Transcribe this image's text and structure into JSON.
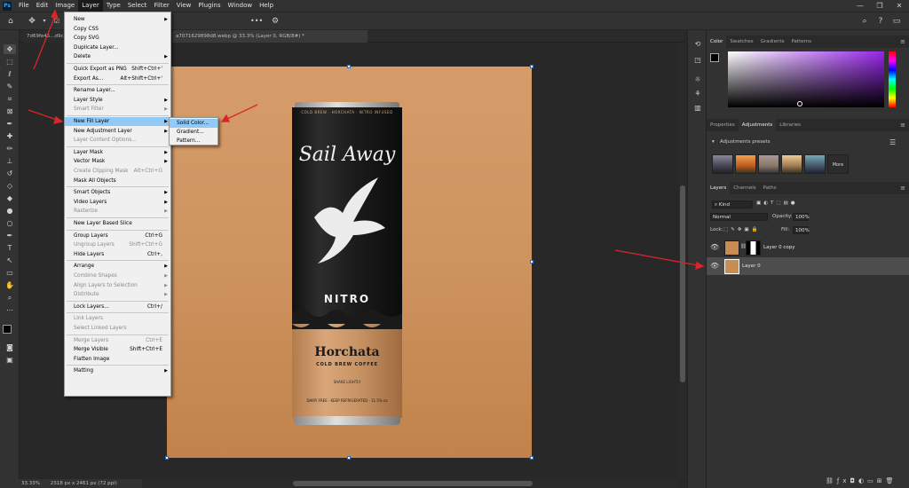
{
  "menubar": {
    "logo": "Ps",
    "items": [
      "File",
      "Edit",
      "Image",
      "Layer",
      "Type",
      "Select",
      "Filter",
      "View",
      "Plugins",
      "Window",
      "Help"
    ],
    "active": "Layer",
    "window_controls": [
      "—",
      "❐",
      "✕"
    ]
  },
  "document": {
    "tab_left": "7d69fe45...d9c69",
    "tab_right": "a7071629898d8.webp @ 33.3% (Layer 0, RGB/8#) *",
    "zoom": "33.33%",
    "doc_info": "2318 px x 2461 px (72 ppi)"
  },
  "layer_menu": {
    "items": [
      {
        "label": "New",
        "shortcut": "",
        "submenu": true,
        "disabled": false
      },
      {
        "label": "Copy CSS",
        "shortcut": "",
        "submenu": false,
        "disabled": false
      },
      {
        "label": "Copy SVG",
        "shortcut": "",
        "submenu": false,
        "disabled": false
      },
      {
        "label": "Duplicate Layer...",
        "shortcut": "",
        "submenu": false,
        "disabled": false
      },
      {
        "label": "Delete",
        "shortcut": "",
        "submenu": true,
        "disabled": false
      },
      {
        "label": "Quick Export as PNG",
        "shortcut": "Shift+Ctrl+'",
        "submenu": false,
        "disabled": false
      },
      {
        "label": "Export As...",
        "shortcut": "Alt+Shift+Ctrl+'",
        "submenu": false,
        "disabled": false
      },
      {
        "label": "Rename Layer...",
        "shortcut": "",
        "submenu": false,
        "disabled": false
      },
      {
        "label": "Layer Style",
        "shortcut": "",
        "submenu": true,
        "disabled": false
      },
      {
        "label": "Smart Filter",
        "shortcut": "",
        "submenu": true,
        "disabled": true
      },
      {
        "label": "New Fill Layer",
        "shortcut": "",
        "submenu": true,
        "disabled": false,
        "highlighted": true
      },
      {
        "label": "New Adjustment Layer",
        "shortcut": "",
        "submenu": true,
        "disabled": false
      },
      {
        "label": "Layer Content Options...",
        "shortcut": "",
        "submenu": false,
        "disabled": true
      },
      {
        "label": "Layer Mask",
        "shortcut": "",
        "submenu": true,
        "disabled": false
      },
      {
        "label": "Vector Mask",
        "shortcut": "",
        "submenu": true,
        "disabled": false
      },
      {
        "label": "Create Clipping Mask",
        "shortcut": "Alt+Ctrl+G",
        "submenu": false,
        "disabled": true
      },
      {
        "label": "Mask All Objects",
        "shortcut": "",
        "submenu": false,
        "disabled": false
      },
      {
        "label": "Smart Objects",
        "shortcut": "",
        "submenu": true,
        "disabled": false
      },
      {
        "label": "Video Layers",
        "shortcut": "",
        "submenu": true,
        "disabled": false
      },
      {
        "label": "Rasterize",
        "shortcut": "",
        "submenu": true,
        "disabled": true
      },
      {
        "label": "New Layer Based Slice",
        "shortcut": "",
        "submenu": false,
        "disabled": false
      },
      {
        "label": "Group Layers",
        "shortcut": "Ctrl+G",
        "submenu": false,
        "disabled": false
      },
      {
        "label": "Ungroup Layers",
        "shortcut": "Shift+Ctrl+G",
        "submenu": false,
        "disabled": true
      },
      {
        "label": "Hide Layers",
        "shortcut": "Ctrl+,",
        "submenu": false,
        "disabled": false
      },
      {
        "label": "Arrange",
        "shortcut": "",
        "submenu": true,
        "disabled": false
      },
      {
        "label": "Combine Shapes",
        "shortcut": "",
        "submenu": true,
        "disabled": true
      },
      {
        "label": "Align Layers to Selection",
        "shortcut": "",
        "submenu": true,
        "disabled": true
      },
      {
        "label": "Distribute",
        "shortcut": "",
        "submenu": true,
        "disabled": true
      },
      {
        "label": "Lock Layers...",
        "shortcut": "Ctrl+/",
        "submenu": false,
        "disabled": false
      },
      {
        "label": "Link Layers",
        "shortcut": "",
        "submenu": false,
        "disabled": true
      },
      {
        "label": "Select Linked Layers",
        "shortcut": "",
        "submenu": false,
        "disabled": true
      },
      {
        "label": "Merge Layers",
        "shortcut": "Ctrl+E",
        "submenu": false,
        "disabled": true
      },
      {
        "label": "Merge Visible",
        "shortcut": "Shift+Ctrl+E",
        "submenu": false,
        "disabled": false
      },
      {
        "label": "Flatten Image",
        "shortcut": "",
        "submenu": false,
        "disabled": false
      },
      {
        "label": "Matting",
        "shortcut": "",
        "submenu": true,
        "disabled": false
      }
    ]
  },
  "fill_submenu": {
    "items": [
      "Solid Color...",
      "Gradient...",
      "Pattern..."
    ],
    "highlighted": "Solid Color..."
  },
  "can": {
    "brand": "Sail Away",
    "top_band": "COLD BREW · HORCHATA · NITRO INFUSED",
    "nitro": "NITRO",
    "flavor": "Horchata",
    "subtitle": "COLD BREW COFFEE",
    "shake": "SHAKE LIGHTLY",
    "bottom_band": "DAIRY FREE · KEEP REFRIGERATED · 11.5% oz"
  },
  "color_panel": {
    "tabs": [
      "Color",
      "Swatches",
      "Gradients",
      "Patterns"
    ],
    "active": "Color",
    "foreground": "#000000",
    "background": "#ffffff",
    "hue_color": "#9626e8"
  },
  "adjust_panel": {
    "tabs": [
      "Properties",
      "Adjustments",
      "Libraries"
    ],
    "active": "Adjustments",
    "presets_label": "Adjustments presets",
    "more_label": "More"
  },
  "layers_panel": {
    "tabs": [
      "Layers",
      "Channels",
      "Paths"
    ],
    "active": "Layers",
    "kind": "Kind",
    "blend_mode": "Normal",
    "opacity_label": "Opacity:",
    "opacity": "100%",
    "lock_label": "Lock:",
    "fill_label": "Fill:",
    "fill": "100%",
    "layers": [
      {
        "name": "Layer 0 copy",
        "selected": false,
        "has_mask": true
      },
      {
        "name": "Layer 0",
        "selected": true,
        "has_mask": false
      }
    ],
    "footer_icons": [
      "link-icon",
      "fx-icon",
      "mask-icon",
      "adjustment-icon",
      "group-icon",
      "new-layer-icon",
      "trash-icon"
    ]
  },
  "colors": {
    "accent": "#2a6fd6",
    "menu_highlight": "#91c9f7",
    "arrow": "#d9262a"
  }
}
